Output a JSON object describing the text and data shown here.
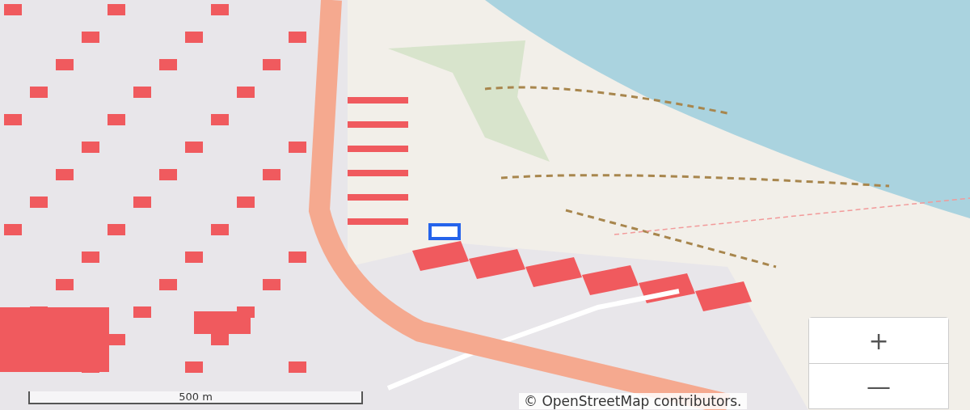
{
  "map": {
    "zoom_controls": [
      {
        "kind": "zoom-in",
        "label": "+"
      },
      {
        "kind": "zoom-out",
        "label": "—"
      }
    ],
    "scale_bar": {
      "label": "500 m"
    },
    "attribution": "© OpenStreetMap contributors."
  }
}
